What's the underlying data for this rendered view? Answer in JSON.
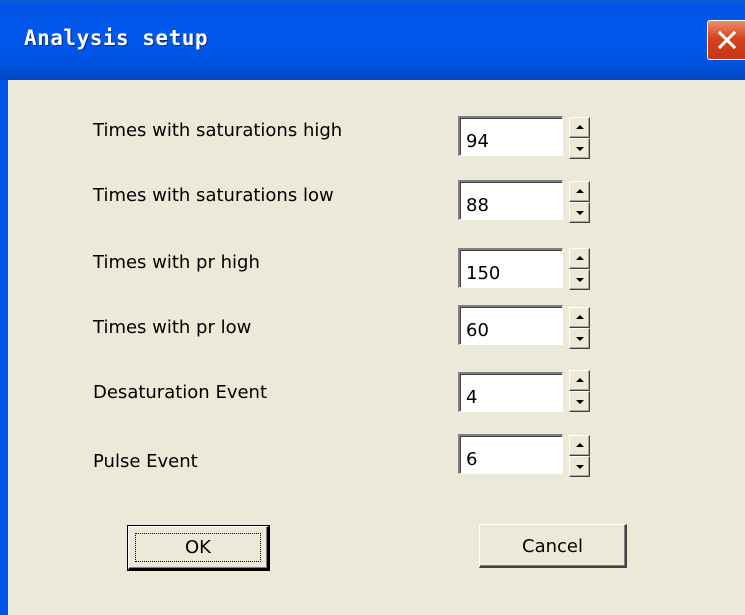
{
  "window": {
    "title": "Analysis setup"
  },
  "settings": [
    {
      "label": "Times with saturations high",
      "value": "94"
    },
    {
      "label": "Times with saturations low",
      "value": "88"
    },
    {
      "label": "Times with pr high",
      "value": "150"
    },
    {
      "label": "Times with pr low",
      "value": "60"
    },
    {
      "label": "Desaturation Event",
      "value": "4"
    },
    {
      "label": "Pulse Event",
      "value": "6"
    }
  ],
  "buttons": {
    "ok": "OK",
    "cancel": "Cancel"
  },
  "icons": {
    "close": "close-icon",
    "spin_up": "spin-up-arrow-icon",
    "spin_down": "spin-down-arrow-icon"
  },
  "colors": {
    "titlebar": "#0054E3",
    "dialog_bg": "#ECE9D8",
    "close_button": "#D8431F"
  }
}
